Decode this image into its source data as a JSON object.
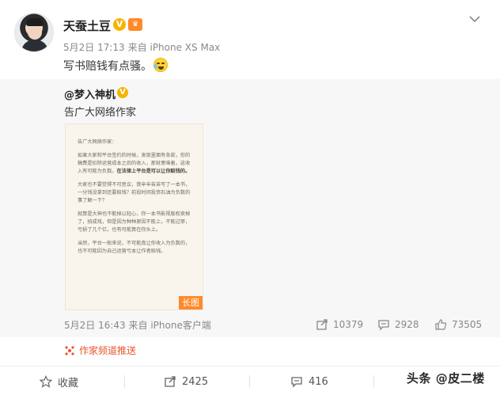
{
  "post": {
    "author": "天蚕土豆",
    "time": "5月2日 17:13",
    "source": "来自 iPhone XS Max",
    "text": "写书赔钱有点骚。"
  },
  "repost": {
    "author": "@梦入神机",
    "text": "告广大网络作家",
    "image_badge": "长图",
    "image_text": {
      "p1": "告广大网络作家：",
      "p2": "如果大家和平台签约的时候，发现里面有条款，你的稿费是扣除运营成本之后的收入，那就意味着，这收入有可能为负数。",
      "p2_bold": "在法律上平台是可以让你赔钱的。",
      "p3": "大家也不要觉得不可思议，我辛辛苦苦写了一本书，一分钱没拿到还要赔钱？前段时间投资石油为负数的事了解一下？",
      "p4": "就算是大神也不能掉以轻心，你一本书影视版权卖掉了，拍成戏，但是因为种种原因不能上，不能过审，亏损了几个亿，也有可能算在你头上。",
      "p5": "当然，平台一般来说，不可能真让你收入为负数的，也不可能因为自己运营亏本让作者赔钱。"
    },
    "time": "5月2日 16:43",
    "source": "来自 iPhone客户端",
    "reposts": "10379",
    "comments": "2928",
    "likes": "73505"
  },
  "push_label": "作家频道推送",
  "bar": {
    "favorite": "收藏",
    "repost": "2425",
    "comment": "416"
  },
  "watermark": "头条 @皮二楼",
  "colors": {
    "accent": "#ff8a2a",
    "push": "#e8542c",
    "verified": "#f6b400"
  }
}
